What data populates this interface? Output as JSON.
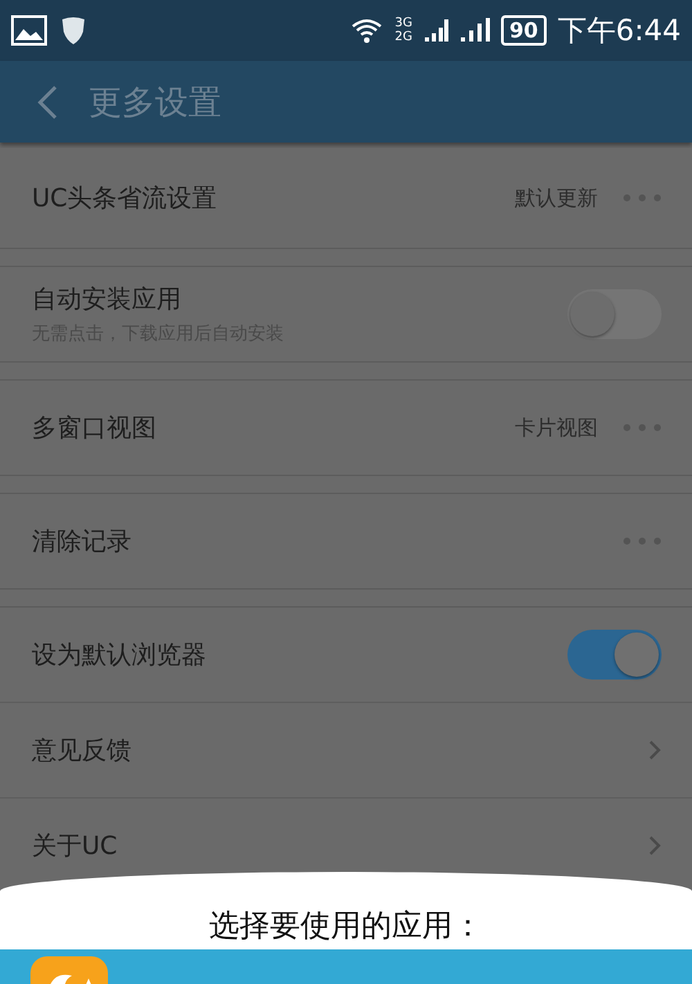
{
  "status_bar": {
    "network_top": "3G",
    "network_bottom": "2G",
    "battery": "90",
    "time": "下午6:44"
  },
  "header": {
    "title": "更多设置"
  },
  "sections": [
    [
      {
        "kind": "value",
        "label": "UC头条省流设置",
        "value": "默认更新"
      }
    ],
    [
      {
        "kind": "toggle",
        "label": "自动安装应用",
        "subtitle": "无需点击，下载应用后自动安装",
        "on": false
      }
    ],
    [
      {
        "kind": "value",
        "label": "多窗口视图",
        "value": "卡片视图"
      }
    ],
    [
      {
        "kind": "more",
        "label": "清除记录"
      }
    ],
    [
      {
        "kind": "toggle",
        "label": "设为默认浏览器",
        "on": true
      },
      {
        "kind": "arrow",
        "label": "意见反馈"
      },
      {
        "kind": "arrow",
        "label": "关于UC"
      }
    ]
  ],
  "chooser": {
    "title": "选择要使用的应用：",
    "apps": [
      {
        "selected": true
      }
    ]
  }
}
